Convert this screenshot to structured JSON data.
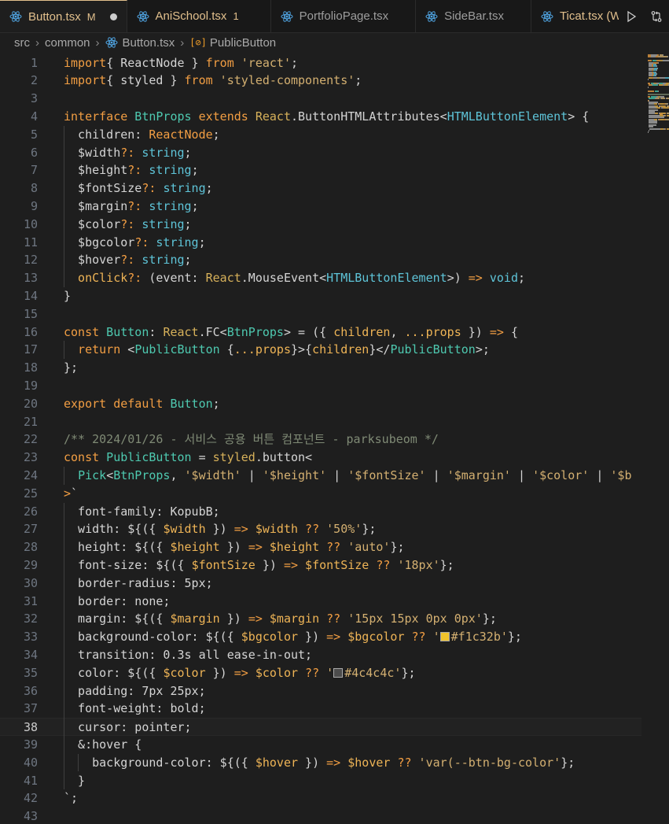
{
  "tabs": [
    {
      "label": "Button.tsx",
      "badge": "M",
      "active": true,
      "dirty": true
    },
    {
      "label": "AniSchool.tsx",
      "badge": "1",
      "active": false
    },
    {
      "label": "PortfolioPage.tsx",
      "badge": "",
      "active": false
    },
    {
      "label": "SideBar.tsx",
      "badge": "",
      "active": false
    },
    {
      "label": "Ticat.tsx (W",
      "badge": "",
      "active": false
    }
  ],
  "tab_actions": [
    "run-icon",
    "git-compare-icon"
  ],
  "breadcrumb": {
    "parts": [
      "src",
      "common",
      "Button.tsx",
      "PublicButton"
    ],
    "icons": [
      "react-icon",
      "symbol-icon"
    ]
  },
  "current_line": 38,
  "colors": {
    "accent": "#e2c08d",
    "swatch_bg": "#f1c32b",
    "swatch_color": "#4c4c4c"
  },
  "code_lines": [
    [
      [
        "kw",
        "import"
      ],
      [
        "",
        "{ ReactNode } "
      ],
      [
        "kw",
        "from"
      ],
      [
        "str",
        " 'react'"
      ],
      [
        "",
        ";"
      ]
    ],
    [
      [
        "kw",
        "import"
      ],
      [
        "",
        "{ styled } "
      ],
      [
        "kw",
        "from"
      ],
      [
        "str",
        " 'styled-components'"
      ],
      [
        "",
        ";"
      ]
    ],
    [],
    [
      [
        "kw",
        "interface"
      ],
      [
        "ty",
        " BtnProps "
      ],
      [
        "kw",
        "extends"
      ],
      [
        "fn",
        " React"
      ],
      [
        "",
        ".ButtonHTMLAttributes<"
      ],
      [
        "ty2",
        "HTMLButtonElement"
      ],
      [
        "",
        "> {"
      ]
    ],
    [
      [
        "",
        "  children: "
      ],
      [
        "kw",
        "ReactNode"
      ],
      [
        "",
        ";"
      ]
    ],
    [
      [
        "",
        "  $width"
      ],
      [
        "kw",
        "?: "
      ],
      [
        "ty2",
        "string"
      ],
      [
        "",
        ";"
      ]
    ],
    [
      [
        "",
        "  $height"
      ],
      [
        "kw",
        "?: "
      ],
      [
        "ty2",
        "string"
      ],
      [
        "",
        ";"
      ]
    ],
    [
      [
        "",
        "  $fontSize"
      ],
      [
        "kw",
        "?: "
      ],
      [
        "ty2",
        "string"
      ],
      [
        "",
        ";"
      ]
    ],
    [
      [
        "",
        "  $margin"
      ],
      [
        "kw",
        "?: "
      ],
      [
        "ty2",
        "string"
      ],
      [
        "",
        ";"
      ]
    ],
    [
      [
        "",
        "  $color"
      ],
      [
        "kw",
        "?: "
      ],
      [
        "ty2",
        "string"
      ],
      [
        "",
        ";"
      ]
    ],
    [
      [
        "",
        "  $bgcolor"
      ],
      [
        "kw",
        "?: "
      ],
      [
        "ty2",
        "string"
      ],
      [
        "",
        ";"
      ]
    ],
    [
      [
        "",
        "  $hover"
      ],
      [
        "kw",
        "?: "
      ],
      [
        "ty2",
        "string"
      ],
      [
        "",
        ";"
      ]
    ],
    [
      [
        "var",
        "  onClick"
      ],
      [
        "kw",
        "?: "
      ],
      [
        "",
        "(event: "
      ],
      [
        "fn",
        "React"
      ],
      [
        "",
        ".MouseEvent<"
      ],
      [
        "ty2",
        "HTMLButtonElement"
      ],
      [
        "",
        ">) "
      ],
      [
        "kw",
        "=>"
      ],
      [
        "ty2",
        " void"
      ],
      [
        "",
        ";"
      ]
    ],
    [
      [
        "",
        "}"
      ]
    ],
    [],
    [
      [
        "kw",
        "const"
      ],
      [
        "ty",
        " Button"
      ],
      [
        "",
        ": "
      ],
      [
        "fn",
        "React"
      ],
      [
        "",
        ".FC<"
      ],
      [
        "ty",
        "BtnProps"
      ],
      [
        "",
        "> = ({ "
      ],
      [
        "var",
        "children"
      ],
      [
        "",
        ", "
      ],
      [
        "var",
        "...props"
      ],
      [
        "",
        " }) "
      ],
      [
        "kw",
        "=>"
      ],
      [
        "",
        " {"
      ]
    ],
    [
      [
        "kw",
        "  return"
      ],
      [
        "",
        " <"
      ],
      [
        "ty",
        "PublicButton"
      ],
      [
        "",
        " {"
      ],
      [
        "var",
        "...props"
      ],
      [
        "",
        "}>{"
      ],
      [
        "var",
        "children"
      ],
      [
        "",
        "}</"
      ],
      [
        "ty",
        "PublicButton"
      ],
      [
        "",
        ">;"
      ]
    ],
    [
      [
        "",
        "};"
      ]
    ],
    [],
    [
      [
        "kw",
        "export"
      ],
      [
        "kw",
        " default"
      ],
      [
        "ty",
        " Button"
      ],
      [
        "",
        ";"
      ]
    ],
    [],
    [
      [
        "cm",
        "/** 2024/01/26 - 서비스 공용 버튼 컴포넌트 - parksubeom */"
      ]
    ],
    [
      [
        "kw",
        "const"
      ],
      [
        "ty",
        " PublicButton"
      ],
      [
        "",
        " = "
      ],
      [
        "fn",
        "styled"
      ],
      [
        "",
        ".button<"
      ]
    ],
    [
      [
        "",
        "  "
      ],
      [
        "ty",
        "Pick"
      ],
      [
        "",
        "<"
      ],
      [
        "ty",
        "BtnProps"
      ],
      [
        "",
        ", "
      ],
      [
        "str",
        "'$width'"
      ],
      [
        "",
        " | "
      ],
      [
        "str",
        "'$height'"
      ],
      [
        "",
        " | "
      ],
      [
        "str",
        "'$fontSize'"
      ],
      [
        "",
        " | "
      ],
      [
        "str",
        "'$margin'"
      ],
      [
        "",
        " | "
      ],
      [
        "str",
        "'$color'"
      ],
      [
        "",
        " | "
      ],
      [
        "str",
        "'$b"
      ]
    ],
    [
      [
        "kw",
        ">"
      ],
      [
        "",
        "`"
      ]
    ],
    [
      [
        "",
        "  font-family: KopubB;"
      ]
    ],
    [
      [
        "",
        "  width: ${({ "
      ],
      [
        "var",
        "$width"
      ],
      [
        "",
        " }) "
      ],
      [
        "kw",
        "=>"
      ],
      [
        "var",
        " $width"
      ],
      [
        "kw",
        " ??"
      ],
      [
        "str",
        " '50%'"
      ],
      [
        "",
        "};"
      ]
    ],
    [
      [
        "",
        "  height: ${({ "
      ],
      [
        "var",
        "$height"
      ],
      [
        "",
        " }) "
      ],
      [
        "kw",
        "=>"
      ],
      [
        "var",
        " $height"
      ],
      [
        "kw",
        " ??"
      ],
      [
        "str",
        " 'auto'"
      ],
      [
        "",
        "};"
      ]
    ],
    [
      [
        "",
        "  font-size: ${({ "
      ],
      [
        "var",
        "$fontSize"
      ],
      [
        "",
        " }) "
      ],
      [
        "kw",
        "=>"
      ],
      [
        "var",
        " $fontSize"
      ],
      [
        "kw",
        " ??"
      ],
      [
        "str",
        " '18px'"
      ],
      [
        "",
        "};"
      ]
    ],
    [
      [
        "",
        "  border-radius: 5px;"
      ]
    ],
    [
      [
        "",
        "  border: none;"
      ]
    ],
    [
      [
        "",
        "  margin: ${({ "
      ],
      [
        "var",
        "$margin"
      ],
      [
        "",
        " }) "
      ],
      [
        "kw",
        "=>"
      ],
      [
        "var",
        " $margin"
      ],
      [
        "kw",
        " ??"
      ],
      [
        "str",
        " '15px 15px 0px 0px'"
      ],
      [
        "",
        "};"
      ]
    ],
    [
      [
        "",
        "  background-color: ${({ "
      ],
      [
        "var",
        "$bgcolor"
      ],
      [
        "",
        " }) "
      ],
      [
        "kw",
        "=>"
      ],
      [
        "var",
        " $bgcolor"
      ],
      [
        "kw",
        " ??"
      ],
      [
        "str",
        " '"
      ],
      [
        "swatch",
        "#f1c32b"
      ],
      [
        "str",
        "#f1c32b'"
      ],
      [
        "",
        "};"
      ]
    ],
    [
      [
        "",
        "  transition: 0.3s all ease-in-out;"
      ]
    ],
    [
      [
        "",
        "  color: ${({ "
      ],
      [
        "var",
        "$color"
      ],
      [
        "",
        " }) "
      ],
      [
        "kw",
        "=>"
      ],
      [
        "var",
        " $color"
      ],
      [
        "kw",
        " ??"
      ],
      [
        "str",
        " '"
      ],
      [
        "swatch",
        "#4c4c4c"
      ],
      [
        "str",
        "#4c4c4c'"
      ],
      [
        "",
        "};"
      ]
    ],
    [
      [
        "",
        "  padding: 7px 25px;"
      ]
    ],
    [
      [
        "",
        "  font-weight: bold;"
      ]
    ],
    [
      [
        "",
        "  cursor: pointer;"
      ]
    ],
    [
      [
        "",
        "  &:hover {"
      ]
    ],
    [
      [
        "",
        "    background-color: ${({ "
      ],
      [
        "var",
        "$hover"
      ],
      [
        "",
        " }) "
      ],
      [
        "kw",
        "=>"
      ],
      [
        "var",
        " $hover"
      ],
      [
        "kw",
        " ??"
      ],
      [
        "str",
        " 'var(--btn-bg-color'"
      ],
      [
        "",
        "};"
      ]
    ],
    [
      [
        "",
        "  }"
      ]
    ],
    [
      [
        "",
        "`;"
      ]
    ],
    []
  ]
}
